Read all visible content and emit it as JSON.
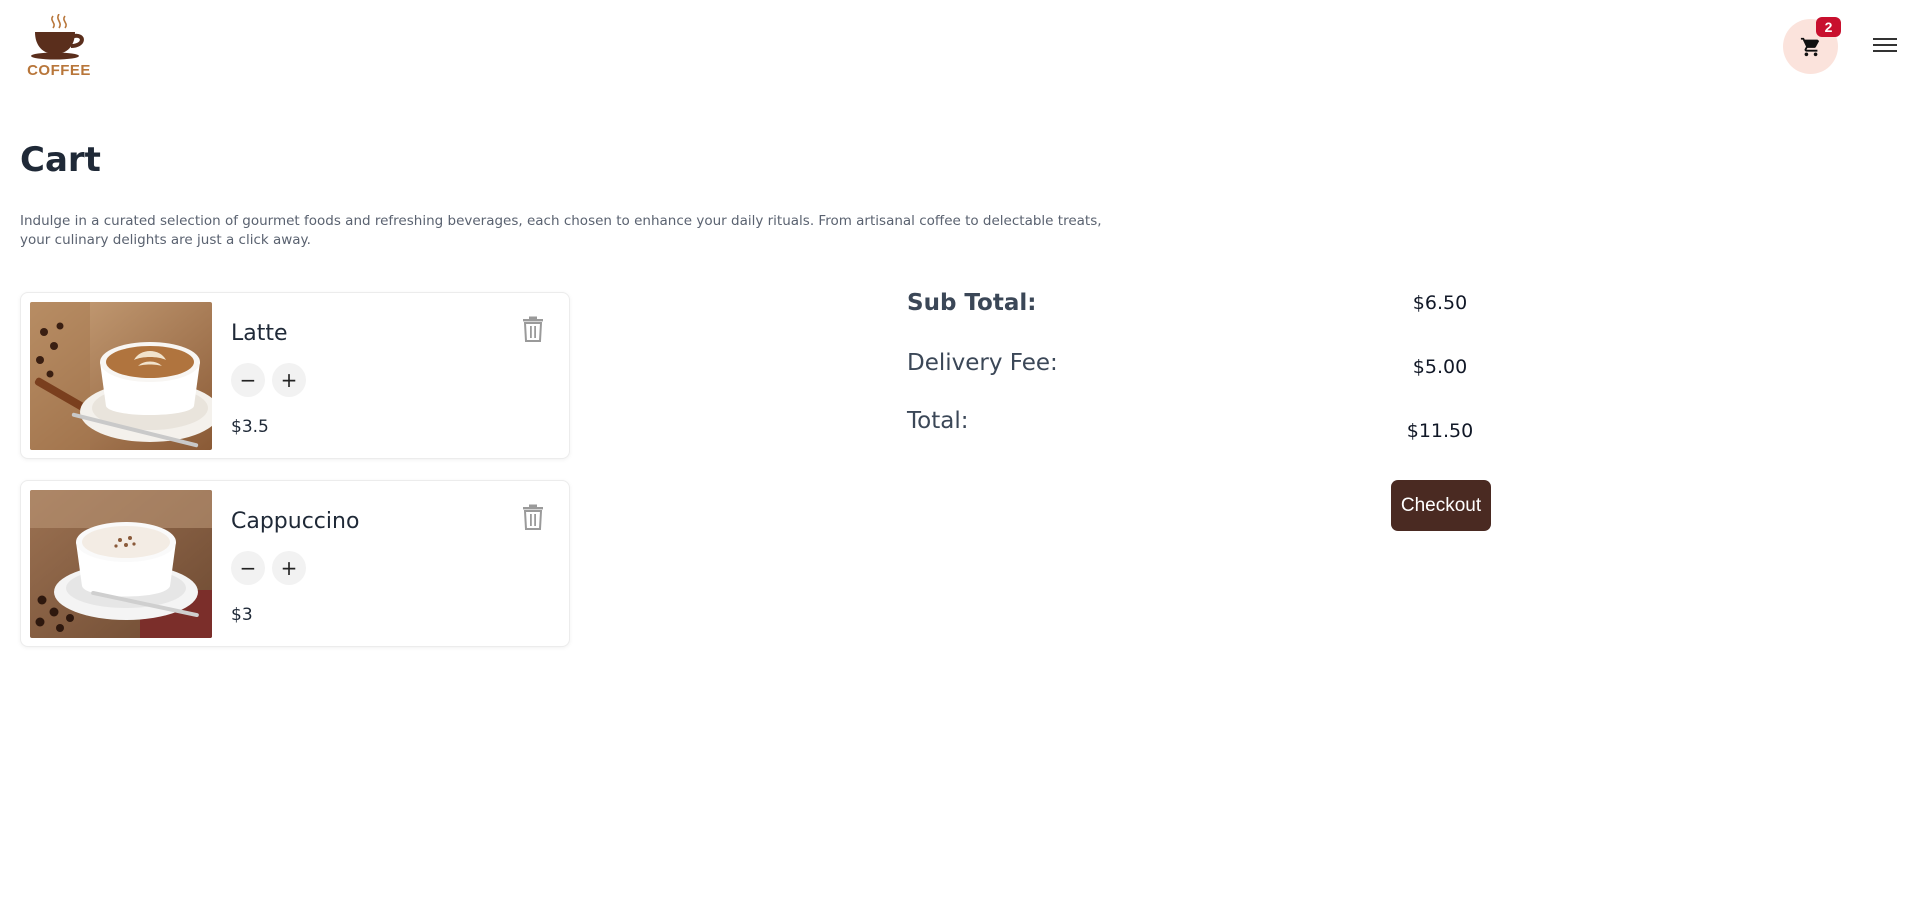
{
  "header": {
    "logo_text": "COFFEE",
    "cart_count": "2"
  },
  "page": {
    "title": "Cart",
    "description": "Indulge in a curated selection of gourmet foods and refreshing beverages, each chosen to enhance your daily rituals. From artisanal coffee to delectable treats, your culinary delights are just a click away."
  },
  "items": [
    {
      "name": "Latte",
      "price": "$3.5",
      "minus": "−",
      "plus": "+"
    },
    {
      "name": "Cappuccino",
      "price": "$3",
      "minus": "−",
      "plus": "+"
    }
  ],
  "summary": {
    "subtotal_label": "Sub Total:",
    "subtotal_value": "$6.50",
    "delivery_label": "Delivery Fee:",
    "delivery_value": "$5.00",
    "total_label": "Total:",
    "total_value": "$11.50",
    "checkout_label": "Checkout"
  },
  "colors": {
    "brand": "#b8763a",
    "badge": "#c8102e",
    "checkout": "#4a2a22",
    "cart_bg": "#fbe3dc"
  },
  "icons": [
    "coffee-cup-logo-icon",
    "cart-icon",
    "menu-icon",
    "trash-icon"
  ]
}
